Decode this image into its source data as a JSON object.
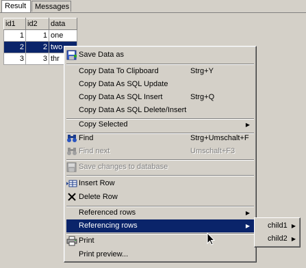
{
  "tabs": {
    "result": "Result",
    "messages": "Messages"
  },
  "grid": {
    "columns": [
      "id1",
      "id2",
      "data"
    ],
    "rows": [
      [
        "1",
        "1",
        "one"
      ],
      [
        "2",
        "2",
        "two"
      ],
      [
        "3",
        "3",
        "thr"
      ]
    ],
    "selected_row_index": 1
  },
  "menu": {
    "save_data_as": "Save Data as",
    "copy_clipboard": "Copy Data To Clipboard",
    "copy_clipboard_sc": "Strg+Y",
    "copy_sql_update": "Copy Data As SQL Update",
    "copy_sql_insert": "Copy Data As SQL Insert",
    "copy_sql_insert_sc": "Strg+Q",
    "copy_sql_delete_insert": "Copy Data As SQL Delete/Insert",
    "copy_selected": "Copy Selected",
    "find": "Find",
    "find_sc": "Strg+Umschalt+F",
    "find_next": "Find next",
    "find_next_sc": "Umschalt+F3",
    "save_changes": "Save changes to database",
    "insert_row": "Insert Row",
    "delete_row": "Delete Row",
    "referenced_rows": "Referenced rows",
    "referencing_rows": "Referencing rows",
    "print": "Print",
    "print_preview": "Print preview..."
  },
  "submenu": {
    "child1": "child1",
    "child2": "child2"
  },
  "icons": [
    "save-icon",
    "binoculars-icon",
    "binoculars-disabled-icon",
    "save-disabled-icon",
    "insert-row-icon",
    "delete-x-icon",
    "printer-icon",
    "submenu-arrow-icon",
    "mouse-pointer-icon"
  ],
  "colors": {
    "selection": "#0a246a",
    "face": "#d4d0c8"
  }
}
